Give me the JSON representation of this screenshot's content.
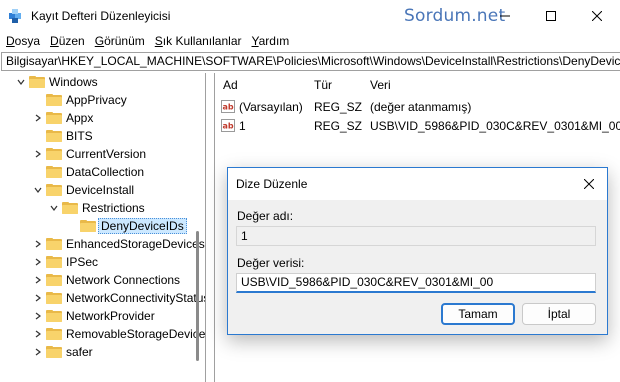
{
  "window": {
    "title": "Kayıt Defteri Düzenleyicisi",
    "watermark": "Sordum.net",
    "icons": {
      "app": "registry-cube-icon",
      "minimize": "minimize-icon",
      "maximize": "maximize-icon",
      "close": "close-icon"
    }
  },
  "menu": [
    {
      "key": "D",
      "rest": "osya"
    },
    {
      "key": "D",
      "rest": "üzen"
    },
    {
      "key": "G",
      "rest": "örünüm"
    },
    {
      "key": "S",
      "rest": "ık Kullanılanlar"
    },
    {
      "key": "Y",
      "rest": "ardım"
    }
  ],
  "address": "Bilgisayar\\HKEY_LOCAL_MACHINE\\SOFTWARE\\Policies\\Microsoft\\Windows\\DeviceInstall\\Restrictions\\DenyDeviceIDs",
  "tree": {
    "items": [
      {
        "label": "Windows",
        "expanded": true
      },
      {
        "label": "AppPrivacy"
      },
      {
        "label": "Appx"
      },
      {
        "label": "BITS"
      },
      {
        "label": "CurrentVersion"
      },
      {
        "label": "DataCollection"
      },
      {
        "label": "DeviceInstall",
        "expanded": true
      },
      {
        "label": "Restrictions",
        "expanded": true
      },
      {
        "label": "DenyDeviceIDs",
        "selected": true
      },
      {
        "label": "EnhancedStorageDevices"
      },
      {
        "label": "IPSec"
      },
      {
        "label": "Network Connections"
      },
      {
        "label": "NetworkConnectivityStatusIndicator"
      },
      {
        "label": "NetworkProvider"
      },
      {
        "label": "RemovableStorageDevices"
      },
      {
        "label": "safer"
      }
    ]
  },
  "list": {
    "headers": {
      "name": "Ad",
      "type": "Tür",
      "data": "Veri"
    },
    "rows": [
      {
        "name": "(Varsayılan)",
        "type": "REG_SZ",
        "data": "(değer atanmamış)"
      },
      {
        "name": "1",
        "type": "REG_SZ",
        "data": "USB\\VID_5986&PID_030C&REV_0301&MI_00"
      }
    ]
  },
  "dialog": {
    "title": "Dize Düzenle",
    "name_label": "Değer adı:",
    "name_value": "1",
    "data_label": "Değer verisi:",
    "data_value": "USB\\VID_5986&PID_030C&REV_0301&MI_00",
    "ok_label": "Tamam",
    "cancel_label": "İptal"
  },
  "colors": {
    "accent": "#2b79d0",
    "folder": "#f8d36b",
    "watermark": "#4a76b8"
  }
}
